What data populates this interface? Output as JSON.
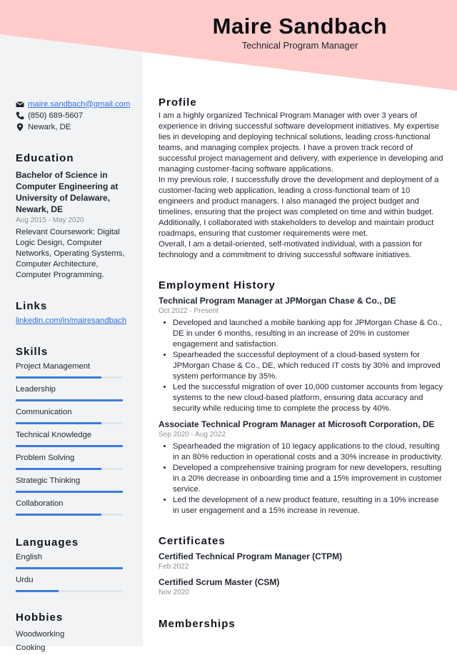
{
  "colors": {
    "header_accent": "#ffcbcb",
    "sidebar_bg": "#f2f3f5",
    "skill_bar": "#3b7ddd",
    "link": "#2f6fdc"
  },
  "header": {
    "name": "Maire Sandbach",
    "title": "Technical Program Manager"
  },
  "contact": {
    "email": {
      "icon": "envelope-icon",
      "value": "maire.sandbach@gmail.com"
    },
    "phone": {
      "icon": "phone-icon",
      "value": "(850) 689-5607"
    },
    "location": {
      "icon": "map-pin-icon",
      "value": "Newark, DE"
    }
  },
  "education": {
    "heading": "Education",
    "degree": "Bachelor of Science in Computer Engineering at University of Delaware, Newark, DE",
    "dates": "Aug 2015 - May 2020",
    "details": "Relevant Coursework: Digital Logic Design, Computer Networks, Operating Systems, Computer Architecture, Computer Programming."
  },
  "links": {
    "heading": "Links",
    "items": [
      {
        "label": "linkedin.com/in/mairesandbach"
      }
    ]
  },
  "skills": {
    "heading": "Skills",
    "items": [
      {
        "label": "Project Management",
        "level": 0.8
      },
      {
        "label": "Leadership",
        "level": 1.0
      },
      {
        "label": "Communication",
        "level": 0.8
      },
      {
        "label": "Technical Knowledge",
        "level": 1.0
      },
      {
        "label": "Problem Solving",
        "level": 0.8
      },
      {
        "label": "Strategic Thinking",
        "level": 1.0
      },
      {
        "label": "Collaboration",
        "level": 0.8
      }
    ]
  },
  "languages": {
    "heading": "Languages",
    "items": [
      {
        "label": "English",
        "level": 1.0
      },
      {
        "label": "Urdu",
        "level": 0.4
      }
    ]
  },
  "hobbies": {
    "heading": "Hobbies",
    "items": [
      "Woodworking",
      "Cooking"
    ]
  },
  "profile": {
    "heading": "Profile",
    "paragraphs": [
      "I am a highly organized Technical Program Manager with over 3 years of experience in driving successful software development initiatives. My expertise lies in developing and deploying technical solutions, leading cross-functional teams, and managing complex projects. I have a proven track record of successful project management and delivery, with experience in developing and managing customer-facing software applications.",
      "In my previous role, I successfully drove the development and deployment of a customer-facing web application, leading a cross-functional team of 10 engineers and product managers. I also managed the project budget and timelines, ensuring that the project was completed on time and within budget. Additionally, I collaborated with stakeholders to develop and maintain product roadmaps, ensuring that customer requirements were met.",
      "Overall, I am a detail-oriented, self-motivated individual, with a passion for technology and a commitment to driving successful software initiatives."
    ]
  },
  "employment": {
    "heading": "Employment History",
    "jobs": [
      {
        "title": "Technical Program Manager at JPMorgan Chase & Co., DE",
        "dates": "Oct 2022 - Present",
        "bullets": [
          "Developed and launched a mobile banking app for JPMorgan Chase & Co., DE in under 6 months, resulting in an increase of 20% in customer engagement and satisfaction.",
          "Spearheaded the successful deployment of a cloud-based system for JPMorgan Chase & Co., DE, which reduced IT costs by 30% and improved system performance by 35%.",
          "Led the successful migration of over 10,000 customer accounts from legacy systems to the new cloud-based platform, ensuring data accuracy and security while reducing time to complete the process by 40%."
        ]
      },
      {
        "title": "Associate Technical Program Manager at Microsoft Corporation, DE",
        "dates": "Sep 2020 - Aug 2022",
        "bullets": [
          "Spearheaded the migration of 10 legacy applications to the cloud, resulting in an 80% reduction in operational costs and a 30% increase in productivity.",
          "Developed a comprehensive training program for new developers, resulting in a 20% decrease in onboarding time and a 15% improvement in customer service.",
          "Led the development of a new product feature, resulting in a 10% increase in user engagement and a 15% increase in revenue."
        ]
      }
    ]
  },
  "certificates": {
    "heading": "Certificates",
    "items": [
      {
        "title": "Certified Technical Program Manager (CTPM)",
        "date": "Feb 2022"
      },
      {
        "title": "Certified Scrum Master (CSM)",
        "date": "Nov 2020"
      }
    ]
  },
  "memberships": {
    "heading": "Memberships"
  }
}
